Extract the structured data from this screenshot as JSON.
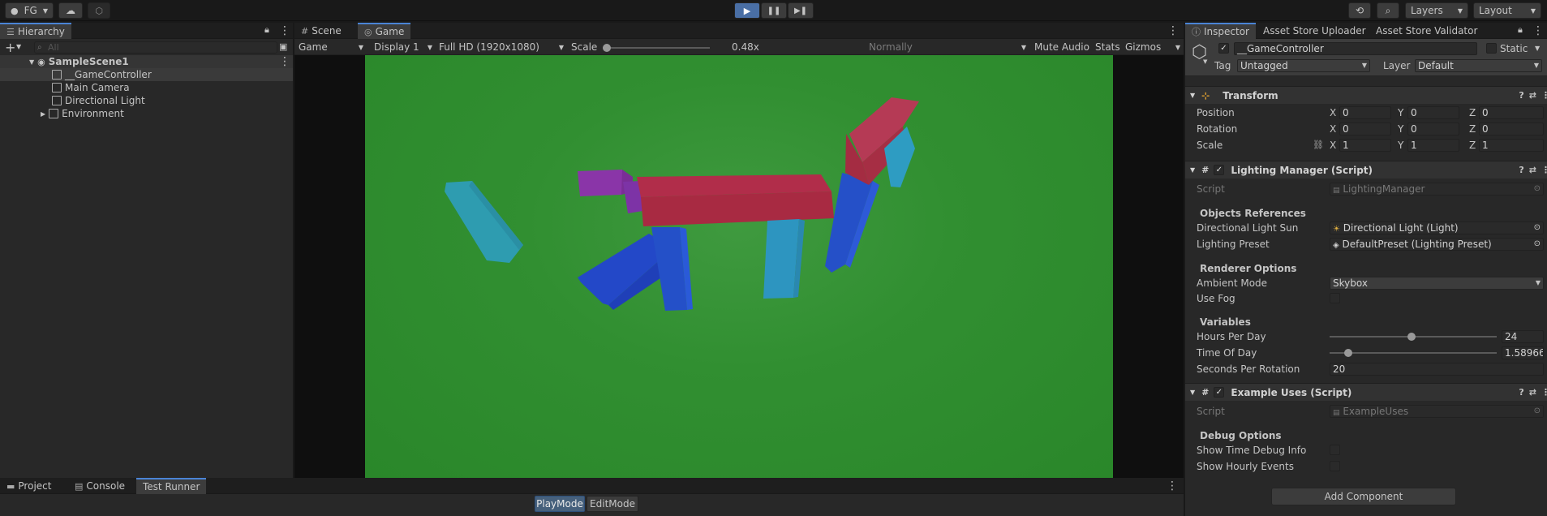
{
  "toolbar": {
    "account": "FG",
    "layers": "Layers",
    "layout": "Layout"
  },
  "hierarchy": {
    "tab": "Hierarchy",
    "search_placeholder": "All",
    "scene": "SampleScene1",
    "items": [
      "__GameController",
      "Main Camera",
      "Directional Light",
      "Environment"
    ]
  },
  "game_view": {
    "tabs": [
      "Scene",
      "Game"
    ],
    "mode": "Game",
    "display": "Display 1",
    "resolution": "Full HD (1920x1080)",
    "scale_label": "Scale",
    "scale_value": "0.48x",
    "play_focus": "Normally",
    "mute_audio": "Mute Audio",
    "stats": "Stats",
    "gizmos": "Gizmos"
  },
  "inspector": {
    "tabs": [
      "Inspector",
      "Asset Store Uploader",
      "Asset Store Validator"
    ],
    "object_name": "__GameController",
    "static_label": "Static",
    "tag_label": "Tag",
    "tag_value": "Untagged",
    "layer_label": "Layer",
    "layer_value": "Default",
    "transform": {
      "title": "Transform",
      "position_label": "Position",
      "rotation_label": "Rotation",
      "scale_label": "Scale",
      "axis_x": "X",
      "axis_y": "Y",
      "axis_z": "Z",
      "position": [
        "0",
        "0",
        "0"
      ],
      "rotation": [
        "0",
        "0",
        "0"
      ],
      "scale": [
        "1",
        "1",
        "1"
      ]
    },
    "lighting_manager": {
      "title": "Lighting Manager (Script)",
      "script_label": "Script",
      "script_value": "LightingManager",
      "objects_refs_title": "Objects References",
      "sun_label": "Directional Light Sun",
      "sun_value": "Directional Light (Light)",
      "preset_label": "Lighting Preset",
      "preset_value": "DefaultPreset (Lighting Preset)",
      "renderer_title": "Renderer Options",
      "ambient_label": "Ambient Mode",
      "ambient_value": "Skybox",
      "fog_label": "Use Fog",
      "variables_title": "Variables",
      "hours_label": "Hours Per Day",
      "hours_value": "24",
      "hours_fraction": 0.49,
      "time_label": "Time Of Day",
      "time_value": "1.58966",
      "time_fraction": 0.09,
      "seconds_label": "Seconds Per Rotation",
      "seconds_value": "20"
    },
    "example_uses": {
      "title": "Example Uses (Script)",
      "script_label": "Script",
      "script_value": "ExampleUses",
      "debug_title": "Debug Options",
      "time_debug_label": "Show Time Debug Info",
      "hourly_label": "Show Hourly Events"
    },
    "add_component": "Add Component"
  },
  "bottom": {
    "tabs": [
      "Project",
      "Console",
      "Test Runner"
    ],
    "playmode": "PlayMode",
    "editmode": "EditMode"
  },
  "colors": {
    "accent": "#4a84d6",
    "background": "#282828",
    "game_bg": "#2f8f2f"
  }
}
